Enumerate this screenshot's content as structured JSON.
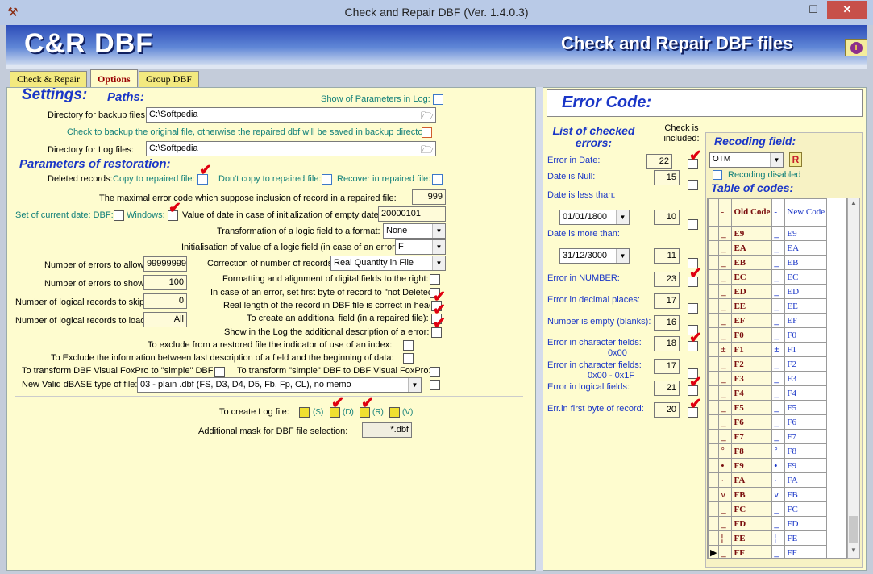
{
  "window": {
    "title": "Check and Repair DBF  (Ver. 1.4.0.3)",
    "minimize": "—",
    "maximize": "☐",
    "close": "✕",
    "app_icon": "tools-icon"
  },
  "banner": {
    "logo": "C&R DBF",
    "title": "Check and Repair DBF files",
    "info": "i"
  },
  "tabs": [
    "Check & Repair",
    "Options",
    "Group DBF"
  ],
  "settings": {
    "title": "Settings:",
    "paths_title": "Paths:",
    "show_params_log": "Show of Parameters in Log:",
    "backup_dir_label": "Directory for backup files:",
    "backup_dir_value": "C:\\Softpedia",
    "backup_check_label": "Check to backup the original file, otherwise the repaired dbf will be saved in backup directory",
    "log_dir_label": "Directory for Log files:",
    "log_dir_value": "C:\\Softpedia",
    "restoration_title": "Parameters of restoration:",
    "deleted_records": "Deleted records:",
    "copy_repaired": "Copy to repaired file:",
    "dont_copy": "Don't copy to repaired file:",
    "recover_repaired": "Recover in repaired file:",
    "max_error_label": "The maximal error code which suppose inclusion of record in a repaired file:",
    "max_error_value": "999",
    "current_date_label": "Set of current date: DBF:",
    "windows_label": "Windows:",
    "init_date_label": "Value of date in case of initialization of empty date:",
    "init_date_value": "20000101",
    "logic_format_label": "Transformation of a logic field to a format:",
    "logic_format_value": "None",
    "logic_init_label": "Initialisation of value of a logic field (in case of an error):",
    "logic_init_value": "F",
    "errors_allow_label": "Number of errors to allow:",
    "errors_allow_value": "99999999",
    "correction_label": "Correction of number of records:",
    "correction_value": "Real Quantity in File",
    "errors_show_label": "Number of errors to show:",
    "errors_show_value": "100",
    "format_align_label": "Formatting and alignment of digital fields to the right:",
    "not_deleted_label": "In case of an error, set first byte of record to \"not Deleted\":",
    "skip_label": "Number of logical records to skip:",
    "skip_value": "0",
    "real_length_label": "Real length of the record in DBF file is correct in header:",
    "load_label": "Number of logical records to load:",
    "load_value": "All",
    "additional_field_label": "To create an additional field (in a repaired file):",
    "additional_desc_label": "Show in the Log the additional description of a error:",
    "exclude_index_label": "To exclude from a restored file the indicator of use of an index:",
    "exclude_info_label": "To Exclude the information between last description of a field and the beginning of data:",
    "vfp_to_simple_label": "To transform DBF Visual FoxPro to \"simple\" DBF:",
    "simple_to_vfp_label": "To transform \"simple\" DBF to DBF Visual FoxPro:",
    "dbase_type_label": "New Valid dBASE type of file:",
    "dbase_type_value": "03 - plain .dbf (FS, D3, D4, D5, Fb, Fp, CL), no memo",
    "create_log_label": "To create Log file:",
    "log_s": "(S)",
    "log_d": "(D)",
    "log_r": "(R)",
    "log_v": "(V)",
    "mask_label": "Additional mask for DBF file selection:",
    "mask_value": "*.dbf"
  },
  "errors": {
    "title": "Error Code:",
    "list_title": "List of checked errors:",
    "check_included": "Check is included:",
    "items": [
      {
        "label": "Error in Date:",
        "value": "22",
        "checked": true
      },
      {
        "label": "Date is Null:",
        "value": "15",
        "checked": false
      },
      {
        "label": "Date is less than:",
        "date": "01/01/1800",
        "value": "10",
        "checked": false
      },
      {
        "label": "Date is more than:",
        "date": "31/12/3000",
        "value": "11",
        "checked": false
      },
      {
        "label": "Error in NUMBER:",
        "value": "23",
        "checked": true
      },
      {
        "label": "Error in decimal places:",
        "value": "17",
        "checked": false
      },
      {
        "label": "Number is empty (blanks):",
        "value": "16",
        "checked": false
      },
      {
        "label": "Error in character fields:",
        "sub": "0x00",
        "value": "18",
        "checked": true
      },
      {
        "label": "Error in character fields:",
        "sub": "0x00 - 0x1F",
        "value": "17",
        "checked": false
      },
      {
        "label": "Error in logical fields:",
        "value": "21",
        "checked": true
      },
      {
        "label": "Err.in first byte of record:",
        "value": "20",
        "checked": true
      }
    ]
  },
  "recoding": {
    "title": "Recoding field:",
    "value": "OTM",
    "r_button": "R",
    "disabled_label": "Recoding disabled",
    "table_title": "Table of codes:",
    "headers": [
      "",
      "-",
      "Old Code",
      "-",
      "New Code"
    ],
    "rows": [
      [
        "",
        "_",
        "E9",
        "_",
        "E9"
      ],
      [
        "",
        "_",
        "EA",
        "_",
        "EA"
      ],
      [
        "",
        "_",
        "EB",
        "_",
        "EB"
      ],
      [
        "",
        "_",
        "EC",
        "_",
        "EC"
      ],
      [
        "",
        "_",
        "ED",
        "_",
        "ED"
      ],
      [
        "",
        "_",
        "EE",
        "_",
        "EE"
      ],
      [
        "",
        "_",
        "EF",
        "_",
        "EF"
      ],
      [
        "",
        "_",
        "F0",
        "_",
        "F0"
      ],
      [
        "",
        "±",
        "F1",
        "±",
        "F1"
      ],
      [
        "",
        "_",
        "F2",
        "_",
        "F2"
      ],
      [
        "",
        "_",
        "F3",
        "_",
        "F3"
      ],
      [
        "",
        "_",
        "F4",
        "_",
        "F4"
      ],
      [
        "",
        "_",
        "F5",
        "_",
        "F5"
      ],
      [
        "",
        "_",
        "F6",
        "_",
        "F6"
      ],
      [
        "",
        "_",
        "F7",
        "_",
        "F7"
      ],
      [
        "",
        "°",
        "F8",
        "°",
        "F8"
      ],
      [
        "",
        "•",
        "F9",
        "•",
        "F9"
      ],
      [
        "",
        "·",
        "FA",
        "·",
        "FA"
      ],
      [
        "",
        "v",
        "FB",
        "v",
        "FB"
      ],
      [
        "",
        "_",
        "FC",
        "_",
        "FC"
      ],
      [
        "",
        "_",
        "FD",
        "_",
        "FD"
      ],
      [
        "",
        "¦",
        "FE",
        "¦",
        "FE"
      ],
      [
        "▶",
        "_",
        "FF",
        "_",
        "FF"
      ]
    ]
  }
}
